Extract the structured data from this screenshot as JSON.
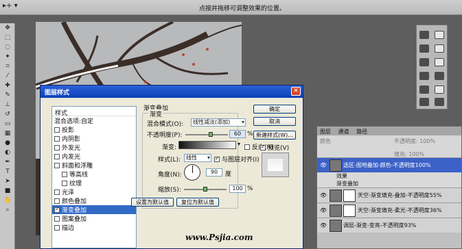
{
  "options_bar": {
    "tool_preset_icon": "move-tool-icon",
    "hint": "点按并拖移可调整效果的位置。"
  },
  "dialog": {
    "title": "图层样式",
    "close_icon": "close-icon",
    "style_list": {
      "header": "样式",
      "items": [
        {
          "label": "混合选项:自定",
          "checkbox": false,
          "checked": false,
          "indent": false,
          "selected": false
        },
        {
          "label": "投影",
          "checkbox": true,
          "checked": false,
          "indent": false,
          "selected": false
        },
        {
          "label": "内阴影",
          "checkbox": true,
          "checked": false,
          "indent": false,
          "selected": false
        },
        {
          "label": "外发光",
          "checkbox": true,
          "checked": false,
          "indent": false,
          "selected": false
        },
        {
          "label": "内发光",
          "checkbox": true,
          "checked": false,
          "indent": false,
          "selected": false
        },
        {
          "label": "斜面和浮雕",
          "checkbox": true,
          "checked": false,
          "indent": false,
          "selected": false
        },
        {
          "label": "等高线",
          "checkbox": true,
          "checked": false,
          "indent": true,
          "selected": false
        },
        {
          "label": "纹理",
          "checkbox": true,
          "checked": false,
          "indent": true,
          "selected": false
        },
        {
          "label": "光泽",
          "checkbox": true,
          "checked": false,
          "indent": false,
          "selected": false
        },
        {
          "label": "颜色叠加",
          "checkbox": true,
          "checked": false,
          "indent": false,
          "selected": false
        },
        {
          "label": "渐变叠加",
          "checkbox": true,
          "checked": true,
          "indent": false,
          "selected": true
        },
        {
          "label": "图案叠加",
          "checkbox": true,
          "checked": false,
          "indent": false,
          "selected": false
        },
        {
          "label": "描边",
          "checkbox": true,
          "checked": false,
          "indent": false,
          "selected": false
        }
      ]
    },
    "section_title": "渐变叠加",
    "group_title": "渐变",
    "blend_mode": {
      "label": "混合模式(O):",
      "value": "线性减淡(添加)"
    },
    "opacity": {
      "label": "不透明度(P):",
      "value": "60",
      "unit": "%",
      "level_percent": 60
    },
    "gradient": {
      "label": "渐变:",
      "reverse_label": "反向(R)",
      "reverse_checked": false
    },
    "style": {
      "label": "样式(L):",
      "value": "线性",
      "align_label": "与图层对齐(I)",
      "align_checked": true
    },
    "angle": {
      "label": "角度(N):",
      "value": "90",
      "unit": "度"
    },
    "scale": {
      "label": "缩放(S):",
      "value": "100",
      "unit": "%",
      "level_percent": 100
    },
    "reset_default": "设置为默认值",
    "restore_default": "复位为默认值",
    "buttons": {
      "ok": "确定",
      "cancel": "取消",
      "new_style": "新建样式(W)...",
      "preview": "预览(V)",
      "preview_checked": true
    }
  },
  "layers_panel": {
    "tabs": [
      "图层",
      "通道",
      "路径"
    ],
    "blend": "颜色",
    "opacity_label": "不透明度: 100%",
    "fill_label": "填充: 100%",
    "layers": [
      {
        "name": "选区-图地叠加-颜色-不透明度100%",
        "selected": true,
        "sub": false,
        "has_mask": false
      },
      {
        "name": "效果",
        "selected": false,
        "sub": true,
        "has_mask": false
      },
      {
        "name": "渐变叠加",
        "selected": false,
        "sub": true,
        "has_mask": false
      },
      {
        "name": "天空-渐变填充-叠加-不透明度55%",
        "selected": false,
        "sub": false,
        "has_mask": true
      },
      {
        "name": "天空-渐变填充-柔光-不透明度36%",
        "selected": false,
        "sub": false,
        "has_mask": true
      },
      {
        "name": "调层-渐变-变亮-不透明度93%",
        "selected": false,
        "sub": false,
        "has_mask": false
      }
    ]
  },
  "watermark": "www.Psjia.com"
}
